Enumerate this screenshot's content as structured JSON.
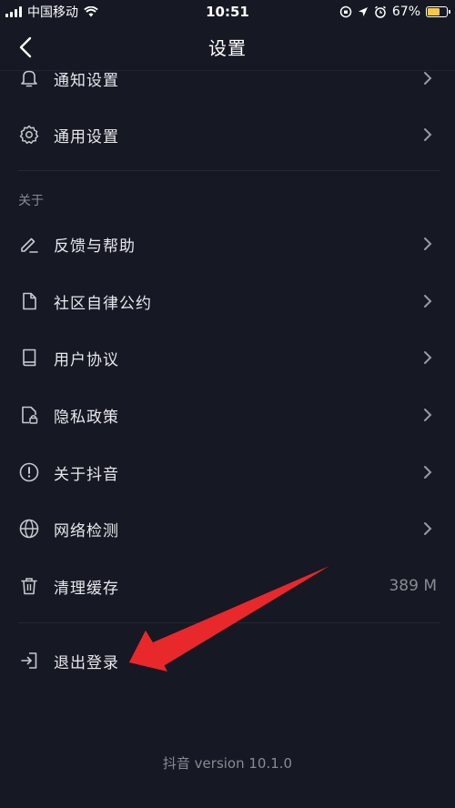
{
  "status": {
    "carrier": "中国移动",
    "time": "10:51",
    "battery": "67%"
  },
  "nav": {
    "title": "设置"
  },
  "rows": [
    {
      "label": "通知设置",
      "icon": "bell-icon"
    },
    {
      "label": "通用设置",
      "icon": "gear-icon"
    }
  ],
  "section_about": "关于",
  "about_rows": [
    {
      "label": "反馈与帮助",
      "icon": "pencil-icon"
    },
    {
      "label": "社区自律公约",
      "icon": "document-icon"
    },
    {
      "label": "用户协议",
      "icon": "book-icon"
    },
    {
      "label": "隐私政策",
      "icon": "lock-document-icon"
    },
    {
      "label": "关于抖音",
      "icon": "info-icon"
    },
    {
      "label": "网络检测",
      "icon": "globe-icon"
    },
    {
      "label": "清理缓存",
      "icon": "trash-icon",
      "value": "389 M"
    }
  ],
  "logout": {
    "label": "退出登录",
    "icon": "logout-icon"
  },
  "version": "抖音 version 10.1.0",
  "colors": {
    "background": "#161823",
    "text": "#e8e8ec",
    "muted": "#8a8b91",
    "annotation_arrow": "#e8282b"
  }
}
